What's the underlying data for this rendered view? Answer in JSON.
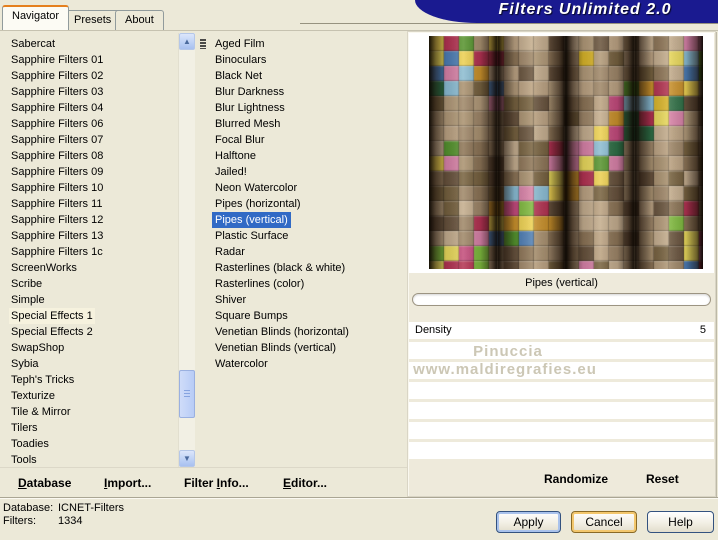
{
  "banner": {
    "title": "Filters Unlimited 2.0"
  },
  "tabs": [
    {
      "label": "Navigator",
      "active": true
    },
    {
      "label": "Presets",
      "active": false
    },
    {
      "label": "About",
      "active": false
    }
  ],
  "category_list": {
    "highlight_index": 17,
    "items": [
      "Sabercat",
      "Sapphire Filters 01",
      "Sapphire Filters 02",
      "Sapphire Filters 03",
      "Sapphire Filters 04",
      "Sapphire Filters 06",
      "Sapphire Filters 07",
      "Sapphire Filters 08",
      "Sapphire Filters 09",
      "Sapphire Filters 10",
      "Sapphire Filters 11",
      "Sapphire Filters 12",
      "Sapphire Filters 13",
      "Sapphire Filters 1c",
      "ScreenWorks",
      "Scribe",
      "Simple",
      "Special Effects 1",
      "Special Effects 2",
      "SwapShop",
      "Sybia",
      "Teph's Tricks",
      "Texturize",
      "Tile & Mirror",
      "Tilers",
      "Toadies",
      "Tools"
    ]
  },
  "filter_list": {
    "selected_index": 11,
    "items": [
      "Aged Film",
      "Binoculars",
      "Black Net",
      "Blur Darkness",
      "Blur Lightness",
      "Blurred Mesh",
      "Focal Blur",
      "Halftone",
      "Jailed!",
      "Neon Watercolor",
      "Pipes (horizontal)",
      "Pipes (vertical)",
      "Plastic Surface",
      "Radar",
      "Rasterlines (black & white)",
      "Rasterlines (color)",
      "Shiver",
      "Square Bumps",
      "Venetian Blinds (horizontal)",
      "Venetian Blinds (vertical)",
      "Watercolor"
    ]
  },
  "preview": {
    "filter_name": "Pipes (vertical)",
    "watermark_line1": "Pinuccia",
    "watermark_line2": "www.maldiregrafies.eu",
    "empty_row_count": 6
  },
  "parameters": [
    {
      "name": "Density",
      "value": "5"
    }
  ],
  "menu_buttons": [
    {
      "label": "Database",
      "underline": 0
    },
    {
      "label": "Import...",
      "underline": 0
    },
    {
      "label": "Filter Info...",
      "underline": 7
    },
    {
      "label": "Editor...",
      "underline": 0
    }
  ],
  "panel_actions": [
    {
      "label": "Randomize",
      "underline": -1
    },
    {
      "label": "Reset",
      "underline": -1
    }
  ],
  "status": {
    "database_label": "Database:",
    "database_value": "ICNET-Filters",
    "filters_label": "Filters:",
    "filters_value": "1334"
  },
  "dialog_buttons": [
    {
      "label": "Apply"
    },
    {
      "label": "Cancel"
    },
    {
      "label": "Help"
    }
  ],
  "colors": {
    "selection_blue": "#316ac5",
    "banner_navy": "#1a1a90",
    "tab_accent_orange": "#e5801e",
    "highlight_cream": "#f6f2de",
    "window_beige": "#ece9d8"
  }
}
